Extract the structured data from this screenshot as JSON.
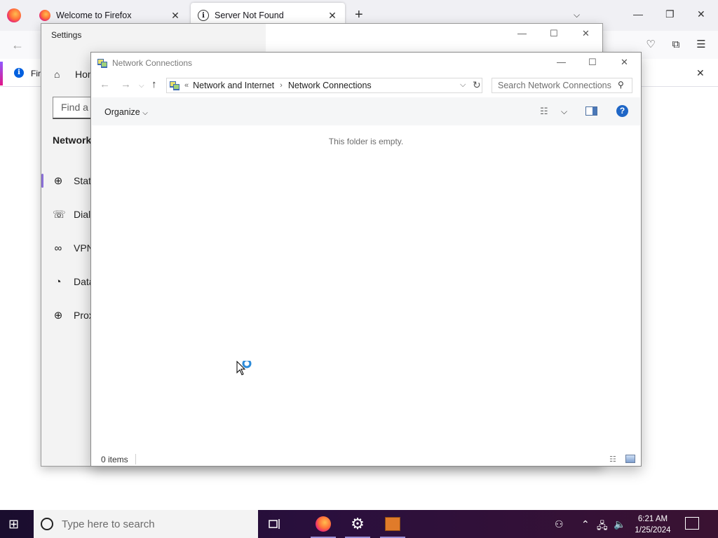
{
  "firefox": {
    "tabs": [
      {
        "label": "Welcome to Firefox",
        "active": false
      },
      {
        "label": "Server Not Found",
        "active": true
      }
    ],
    "notification_text": "Fir"
  },
  "settings": {
    "title": "Settings",
    "home_label": "Hom",
    "search_placeholder": "Find a s",
    "section_title": "Network",
    "nav_items": [
      {
        "label": "Stat",
        "icon": "globe-status-icon",
        "active": true
      },
      {
        "label": "Dial",
        "icon": "dialup-icon",
        "active": false
      },
      {
        "label": "VPN",
        "icon": "vpn-icon",
        "active": false
      },
      {
        "label": "Data",
        "icon": "data-usage-icon",
        "active": false
      },
      {
        "label": "Prox",
        "icon": "proxy-globe-icon",
        "active": false
      }
    ]
  },
  "network_connections": {
    "title": "Network Connections",
    "breadcrumb": [
      "Network and Internet",
      "Network Connections"
    ],
    "search_placeholder": "Search Network Connections",
    "organize_label": "Organize",
    "empty_message": "This folder is empty.",
    "status_count": "0 items"
  },
  "taskbar": {
    "search_placeholder": "Type here to search",
    "time": "6:21 AM",
    "date": "1/25/2024"
  },
  "colors": {
    "accent_purple": "#8a6fd6",
    "help_blue": "#1f66c6",
    "taskbar_bg": "#2a0f3d"
  }
}
